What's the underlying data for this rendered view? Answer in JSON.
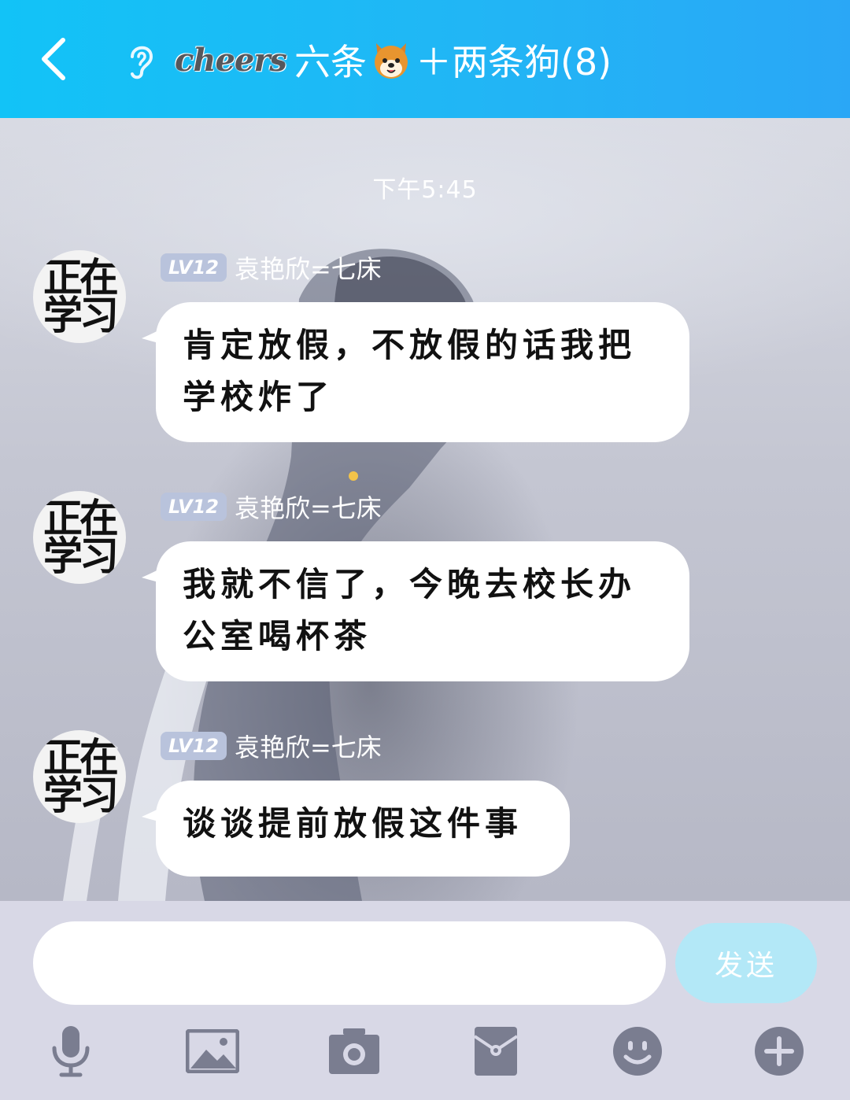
{
  "header": {
    "logo_text": "cheers",
    "group_name": "六条",
    "group_name_suffix": "＋两条狗(8)"
  },
  "chat": {
    "timestamp": "下午5:45",
    "messages": [
      {
        "avatar_line1": "正在",
        "avatar_line2": "学习",
        "level": "LV12",
        "sender": "袁艳欣=七床",
        "text_line1": "肯定放假，不放假的话我把",
        "text_line2": "学校炸了"
      },
      {
        "avatar_line1": "正在",
        "avatar_line2": "学习",
        "level": "LV12",
        "sender": "袁艳欣=七床",
        "text_line1": "我就不信了，今晚去校长办",
        "text_line2": "公室喝杯茶"
      },
      {
        "avatar_line1": "正在",
        "avatar_line2": "学习",
        "level": "LV12",
        "sender": "袁艳欣=七床",
        "text_line1": "谈谈提前放假这件事"
      }
    ]
  },
  "input_bar": {
    "placeholder": "",
    "send_label": "发送",
    "tools": [
      "microphone-icon",
      "image-icon",
      "camera-icon",
      "red-packet-icon",
      "emoji-icon",
      "plus-icon"
    ]
  },
  "colors": {
    "header_start": "#12c3f7",
    "header_end": "#2aa7f6",
    "send_button": "#b3e8f7",
    "tool_icon": "#7a7d90"
  }
}
